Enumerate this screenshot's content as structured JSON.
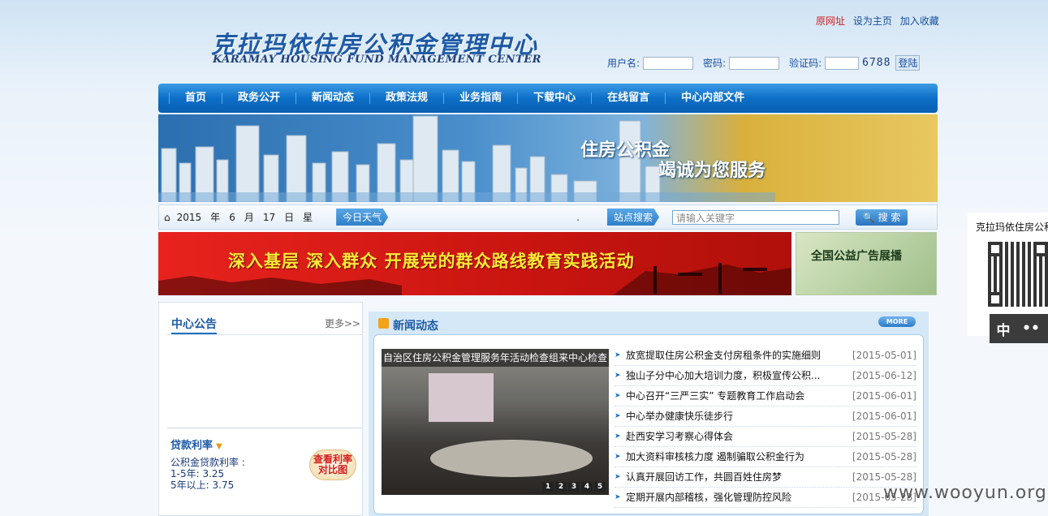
{
  "header": {
    "logo_cn": "克拉玛依住房公积金管理中心",
    "logo_en": "KARAMAY HOUSING FUND MANAGEMENT CENTER",
    "links": [
      "原网址",
      "设为主页",
      "加入收藏"
    ],
    "login": {
      "username_label": "用户名:",
      "password_label": "密码:",
      "captcha_label": "验证码:",
      "captcha_value": "6788",
      "submit_label": "登陆"
    }
  },
  "nav": [
    "首页",
    "政务公开",
    "新闻动态",
    "政策法规",
    "业务指南",
    "下载中心",
    "在线留言",
    "中心内部文件"
  ],
  "banner": {
    "line1": "住房公积金",
    "line2": "竭诚为您服务"
  },
  "infobar": {
    "year": "2015",
    "year_unit": "年",
    "month": "6",
    "month_unit": "月",
    "day": "17",
    "day_unit": "日",
    "weekday": "星",
    "weather_label": "今日天气",
    "dot": ".",
    "search_label": "站点搜索",
    "search_placeholder": "请输入关键字",
    "search_button": "搜 索"
  },
  "slogan": "深入基层  深入群众   开展党的群众路线教育实践活动",
  "psa": "全国公益广告展播",
  "notice": {
    "title": "中心公告",
    "more": "更多>>"
  },
  "rates": {
    "title": "贷款利率",
    "line1": "公积金贷款利率 :",
    "line2": "1-5年: 3.25",
    "line3": "5年以上: 3.75",
    "compare_button_line1": "查看利率",
    "compare_button_line2": "对比图"
  },
  "news": {
    "title": "新闻动态",
    "more": "MORE",
    "photo_caption": "自治区住房公积金管理服务年活动检查组来中心检查",
    "pager": [
      "1",
      "2",
      "3",
      "4",
      "5"
    ],
    "items": [
      {
        "title": "放宽提取住房公积金支付房租条件的实施细则",
        "date": "[2015-05-01]"
      },
      {
        "title": "独山子分中心加大培训力度，积极宣传公积...",
        "date": "[2015-06-12]"
      },
      {
        "title": "中心召开“三严三实” 专题教育工作启动会",
        "date": "[2015-06-01]"
      },
      {
        "title": "中心举办健康快乐徒步行",
        "date": "[2015-06-01]"
      },
      {
        "title": "赴西安学习考察心得体会",
        "date": "[2015-05-28]"
      },
      {
        "title": "加大资料审核核力度 遏制骗取公积金行为",
        "date": "[2015-05-28]"
      },
      {
        "title": "认真开展回访工作，共圆百姓住房梦",
        "date": "[2015-05-28]"
      },
      {
        "title": "定期开展内部稽核，强化管理防控风险",
        "date": "[2015-05-28]"
      }
    ]
  },
  "qr_panel": {
    "title": "克拉玛依住房公积",
    "btn1": "中",
    "btn2": "••"
  },
  "watermark": "www.wooyun.org",
  "colors": {
    "nav_blue": "#0d6fc7",
    "slogan_red": "#d41a14",
    "slogan_text": "#ffea38",
    "link_red": "#d42020"
  }
}
